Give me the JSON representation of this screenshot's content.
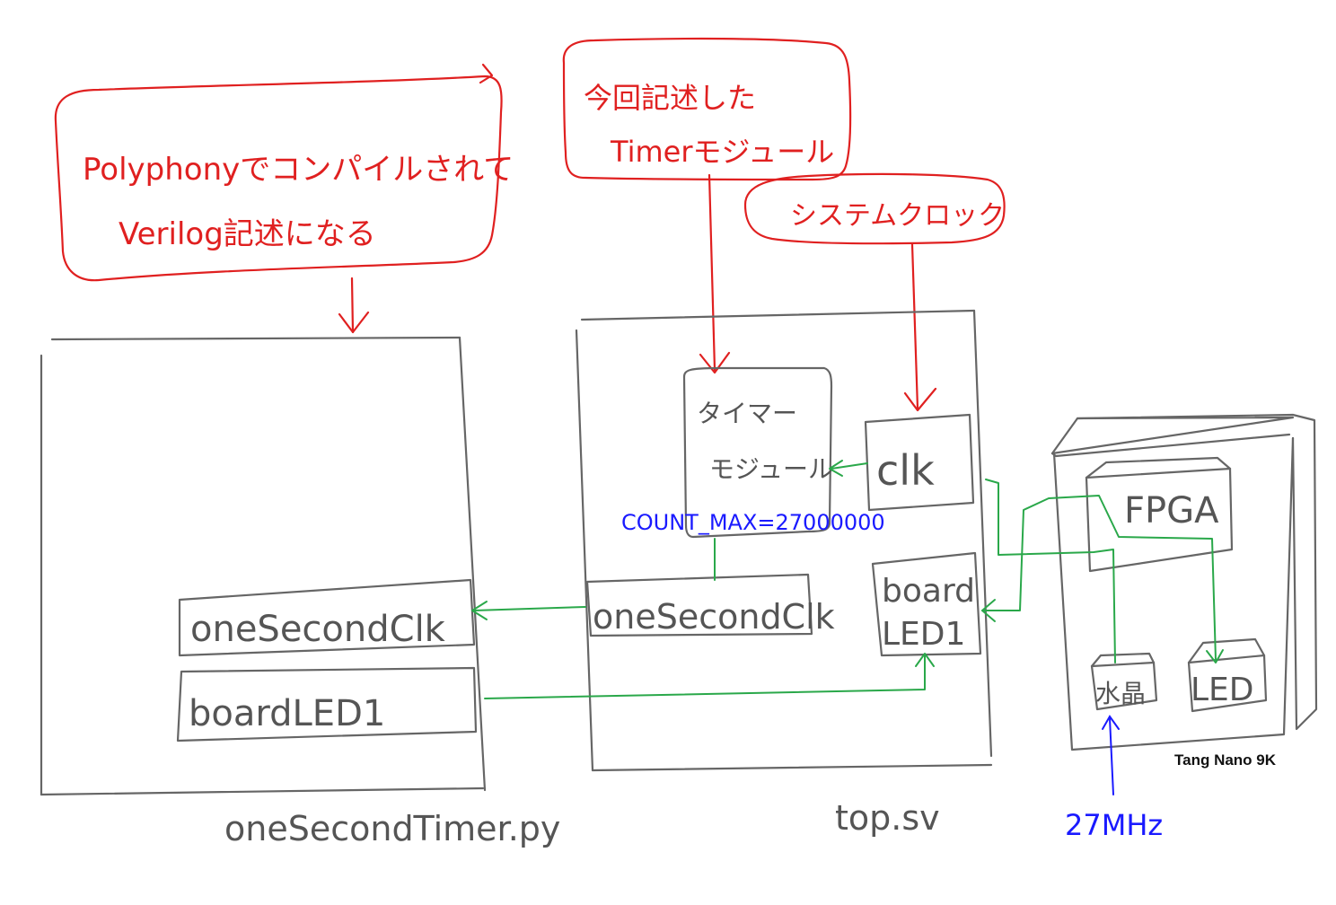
{
  "callouts": {
    "polyphony_line1": "Polyphonyでコンパイルされて",
    "polyphony_line2": "Verilog記述になる",
    "timer_line1": "今回記述した",
    "timer_line2": "Timerモジュール",
    "clock": "システムクロック"
  },
  "left_module": {
    "port1": "oneSecondClk",
    "port2": "boardLED1",
    "caption": "oneSecondTimer.py"
  },
  "top_module": {
    "timer_line1": "タイマー",
    "timer_line2": "モジュール",
    "param": "COUNT_MAX=27000000",
    "clk": "clk",
    "port_onesecond": "oneSecondClk",
    "led_line1": "board",
    "led_line2": "LED1",
    "caption": "top.sv"
  },
  "board": {
    "fpga": "FPGA",
    "crystal": "水晶",
    "led": "LED",
    "name": "Tang Nano 9K",
    "freq": "27MHz"
  },
  "colors": {
    "annotation": "#e02020",
    "signal": "#2aa84a",
    "param": "#1a1aff",
    "outline": "#666666"
  }
}
